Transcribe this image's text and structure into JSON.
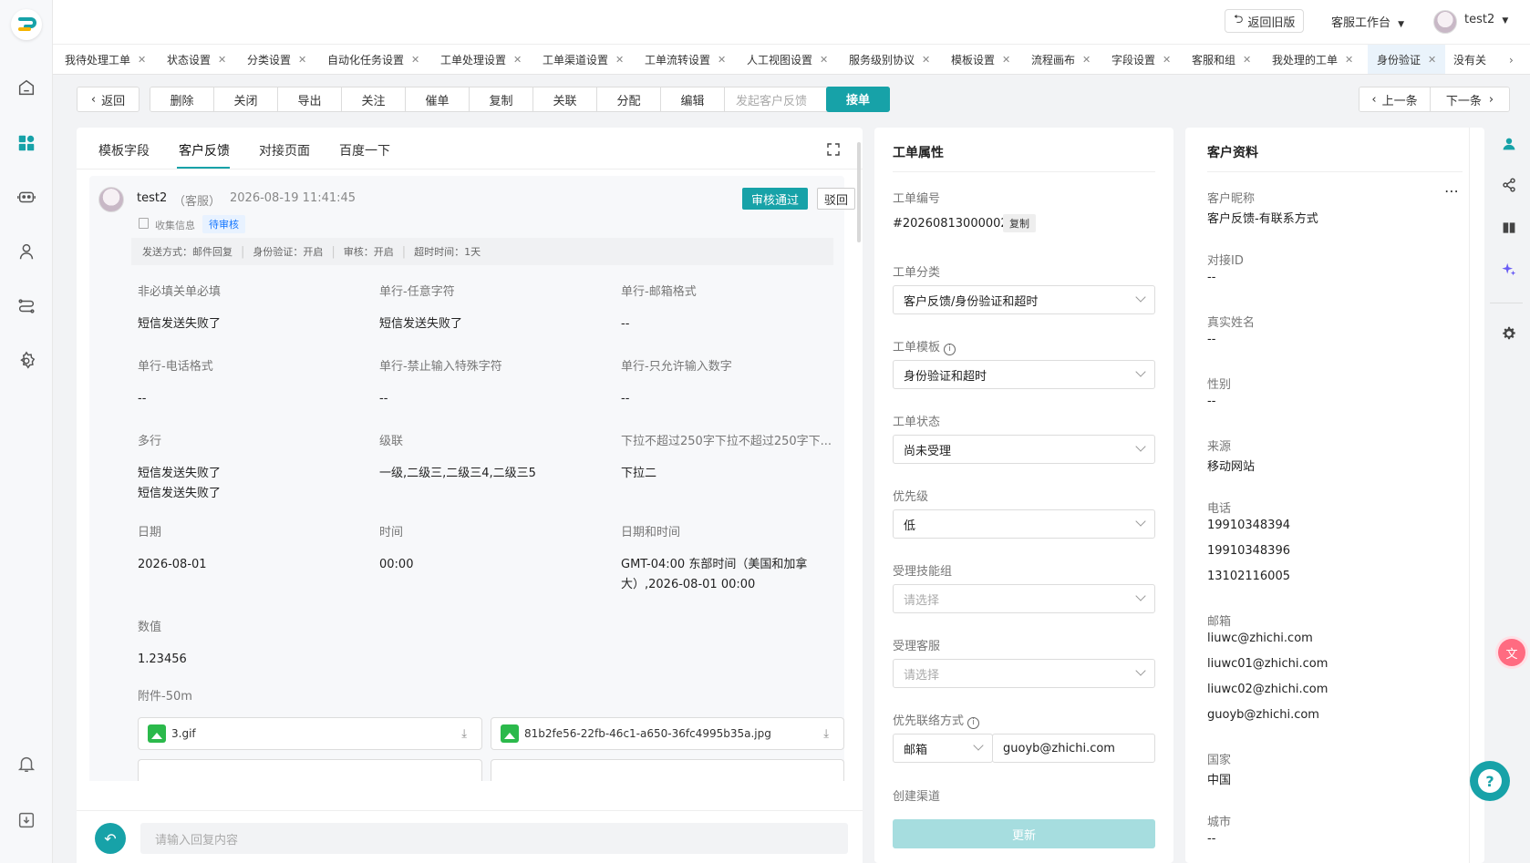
{
  "topbar": {
    "back_old": "返回旧版",
    "workspace": "客服工作台",
    "user": "test2"
  },
  "tabs": [
    {
      "label": "我待处理工单"
    },
    {
      "label": "状态设置"
    },
    {
      "label": "分类设置"
    },
    {
      "label": "自动化任务设置"
    },
    {
      "label": "工单处理设置"
    },
    {
      "label": "工单渠道设置"
    },
    {
      "label": "工单流转设置"
    },
    {
      "label": "人工视图设置"
    },
    {
      "label": "服务级别协议"
    },
    {
      "label": "模板设置"
    },
    {
      "label": "流程画布"
    },
    {
      "label": "字段设置"
    },
    {
      "label": "客服和组"
    },
    {
      "label": "我处理的工单"
    },
    {
      "label": "身份验证"
    },
    {
      "label": "没有关"
    }
  ],
  "toolbar": {
    "back": "返回",
    "actions": [
      "删除",
      "关闭",
      "导出",
      "关注",
      "催单",
      "复制",
      "关联",
      "分配",
      "编辑",
      "发起客户反馈"
    ],
    "accept": "接单",
    "prev": "上一条",
    "next": "下一条"
  },
  "subtabs": [
    "模板字段",
    "客户反馈",
    "对接页面",
    "百度一下"
  ],
  "feedback": {
    "user": "test2",
    "role": "（客服）",
    "time": "2026-08-19 11:41:45",
    "approve": "审核通过",
    "reject": "驳回",
    "collect": "收集信息",
    "status_tag": "待审核",
    "meta": [
      "发送方式：邮件回复",
      "身份验证：开启",
      "审核：开启",
      "超时时间：1天"
    ],
    "fields": [
      {
        "label": "非必填关单必填",
        "value": "短信发送失败了"
      },
      {
        "label": "单行-任意字符",
        "value": "短信发送失败了"
      },
      {
        "label": "单行-邮箱格式",
        "value": "--"
      },
      {
        "label": "单行-电话格式",
        "value": "--"
      },
      {
        "label": "单行-禁止输入特殊字符",
        "value": "--"
      },
      {
        "label": "单行-只允许输入数字",
        "value": "--"
      },
      {
        "label": "多行",
        "value": "短信发送失败了"
      },
      {
        "label": "级联",
        "value": "一级,二级三,二级三4,二级三5"
      },
      {
        "label": "下拉不超过250字下拉不超过250字下...",
        "value": "下拉二"
      },
      {
        "label": "日期",
        "value": "2026-08-01"
      },
      {
        "label": "时间",
        "value": "00:00"
      },
      {
        "label": "日期和时间",
        "value": "GMT-04:00 东部时间（美国和加拿"
      },
      {
        "label": "数值",
        "value": "1.23456"
      },
      {
        "label": "附件-50m",
        "value": ""
      }
    ],
    "multiline_extra": "短信发送失败了",
    "datetime_extra": "大）,2026-08-01 00:00",
    "files": [
      "3.gif",
      "81b2fe56-22fb-46c1-a650-36fc4995b35a.jpg"
    ]
  },
  "reply_placeholder": "请输入回复内容",
  "ticket": {
    "title": "工单属性",
    "id_label": "工单编号",
    "id": "#20260813000002",
    "copy": "复制",
    "category_label": "工单分类",
    "category": "客户反馈/身份验证和超时",
    "template_label": "工单模板",
    "template": "身份验证和超时",
    "status_label": "工单状态",
    "status": "尚未受理",
    "priority_label": "优先级",
    "priority": "低",
    "group_label": "受理技能组",
    "group_ph": "请选择",
    "agent_label": "受理客服",
    "agent_ph": "请选择",
    "contact_label": "优先联络方式",
    "contact_type": "邮箱",
    "contact_value": "guoyb@zhichi.com",
    "channel_label": "创建渠道",
    "update": "更新"
  },
  "customer": {
    "title": "客户资料",
    "nickname_label": "客户昵称",
    "nickname": "客户反馈-有联系方式",
    "dock_label": "对接ID",
    "dock": "--",
    "realname_label": "真实姓名",
    "realname": "--",
    "gender_label": "性别",
    "gender": "--",
    "source_label": "来源",
    "source": "移动网站",
    "phone_label": "电话",
    "phones": [
      "19910348394",
      "19910348396",
      "13102116005"
    ],
    "email_label": "邮箱",
    "emails": [
      "liuwc@zhichi.com",
      "liuwc01@zhichi.com",
      "liuwc02@zhichi.com",
      "guoyb@zhichi.com"
    ],
    "country_label": "国家",
    "country": "中国",
    "city_label": "城市",
    "city": "--"
  },
  "colors": {
    "accent": "#17a2a8",
    "tag_blue": "#1677ff"
  }
}
